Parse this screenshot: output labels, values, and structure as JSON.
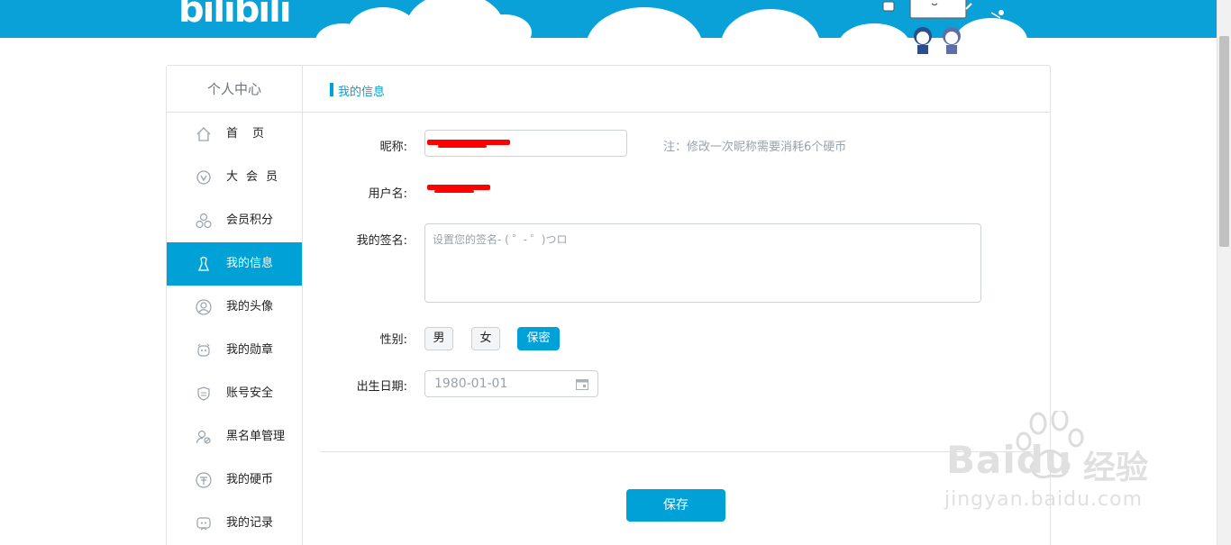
{
  "header": {
    "logo_text": "bilibili"
  },
  "sidebar": {
    "title": "个人中心",
    "items": [
      {
        "label": "首页",
        "icon": "home-icon"
      },
      {
        "label": "大会员",
        "icon": "vip-icon"
      },
      {
        "label": "会员积分",
        "icon": "points-icon"
      },
      {
        "label": "我的信息",
        "icon": "user-icon",
        "active": true
      },
      {
        "label": "我的头像",
        "icon": "avatar-icon"
      },
      {
        "label": "我的勋章",
        "icon": "medal-icon"
      },
      {
        "label": "账号安全",
        "icon": "shield-icon"
      },
      {
        "label": "黑名单管理",
        "icon": "blacklist-icon"
      },
      {
        "label": "我的硬币",
        "icon": "coin-icon"
      },
      {
        "label": "我的记录",
        "icon": "record-icon"
      }
    ]
  },
  "main": {
    "section_title": "我的信息",
    "nickname": {
      "label": "昵称:",
      "note": "注：修改一次昵称需要消耗6个硬币"
    },
    "username": {
      "label": "用户名:"
    },
    "signature": {
      "label": "我的签名:",
      "placeholder": "设置您的签名- ( ゜- ゜)つロ"
    },
    "gender": {
      "label": "性别:",
      "options": [
        "男",
        "女",
        "保密"
      ],
      "selected": "保密"
    },
    "birthday": {
      "label": "出生日期:",
      "value": "1980-01-01"
    },
    "save_label": "保存"
  },
  "watermark": {
    "brand": "Baidu",
    "brand_cn": "经验",
    "url": "jingyan.baidu.com"
  },
  "colors": {
    "accent": "#00a1d6",
    "banner": "#0aa1d8",
    "redaction": "#ff0000"
  }
}
